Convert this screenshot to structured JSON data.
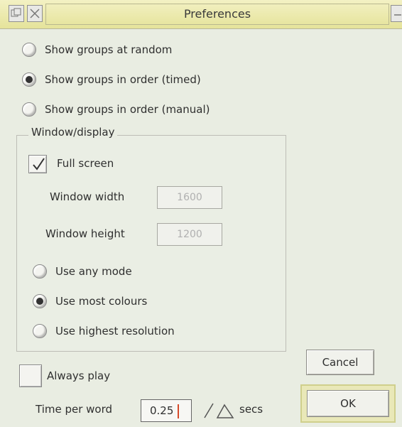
{
  "window": {
    "title": "Preferences"
  },
  "display_mode": {
    "options": [
      {
        "label": "Show groups at random",
        "selected": false
      },
      {
        "label": "Show groups in order (timed)",
        "selected": true
      },
      {
        "label": "Show groups in order (manual)",
        "selected": false
      }
    ]
  },
  "window_display": {
    "group_label": "Window/display",
    "full_screen": {
      "label": "Full screen",
      "checked": true
    },
    "width": {
      "label": "Window width",
      "value": "1600"
    },
    "height": {
      "label": "Window height",
      "value": "1200"
    },
    "mode_options": [
      {
        "label": "Use any mode",
        "selected": false
      },
      {
        "label": "Use most colours",
        "selected": true
      },
      {
        "label": "Use highest resolution",
        "selected": false
      }
    ]
  },
  "always_play": {
    "label": "Always play",
    "checked": false
  },
  "time_per_word": {
    "label": "Time per word",
    "value": "0.25",
    "unit": "secs"
  },
  "buttons": {
    "cancel": "Cancel",
    "ok": "OK"
  },
  "colors": {
    "titlebar": "#ecebb0",
    "background": "#e9ede2",
    "ok_highlight": "#e9e8b8"
  }
}
